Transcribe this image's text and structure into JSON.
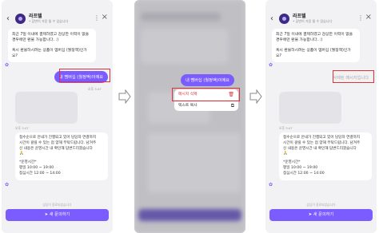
{
  "header": {
    "back_icon": "‹",
    "title": "라프텔",
    "subtitle": "• 답변이 가장 될 수 있습니다",
    "more_icon": "⋮",
    "close_icon": "×"
  },
  "bot_intro": {
    "paragraph1": "최근 7일 이내에 결제하였고 감상한 이력이 없을 경우에만 환불 가능합니다. :)",
    "paragraph2": "혹시 환불하시려는 상품이 멤버십 (월정액)인가요?"
  },
  "user_message": "내 멤버십 (월정액)이에요",
  "deleted_message": "삭제된 메시지입니다",
  "context_menu": {
    "delete_label": "메시지 삭제",
    "delete_icon": "🗑",
    "copy_label": "텍스트 복사",
    "copy_icon": "⧉"
  },
  "timestamps": {
    "t1": "오후 3:47",
    "t2": "오후 3:47"
  },
  "bot_reply": {
    "lines": [
      "접수순으로 안내가 진행되고 있어 담당자 연결까지",
      "시간이 걸릴 수 있는 점 양해 부탁드립니다. 남겨주",
      "신 내용은 운영시간 내 확인해 답변드리겠습니다",
      "🙏",
      "*운영시간*",
      "평일 10:00 ~ 19:00",
      "점심시간 12:00 ~ 14:00"
    ]
  },
  "footer_note": "상담이 종료되었습니다",
  "cta": {
    "icon": "➤",
    "label": "새 문의하기"
  },
  "arrow_icon": "right-arrow-icon",
  "colors": {
    "accent": "#7b5cff",
    "highlight": "#e0303a"
  }
}
